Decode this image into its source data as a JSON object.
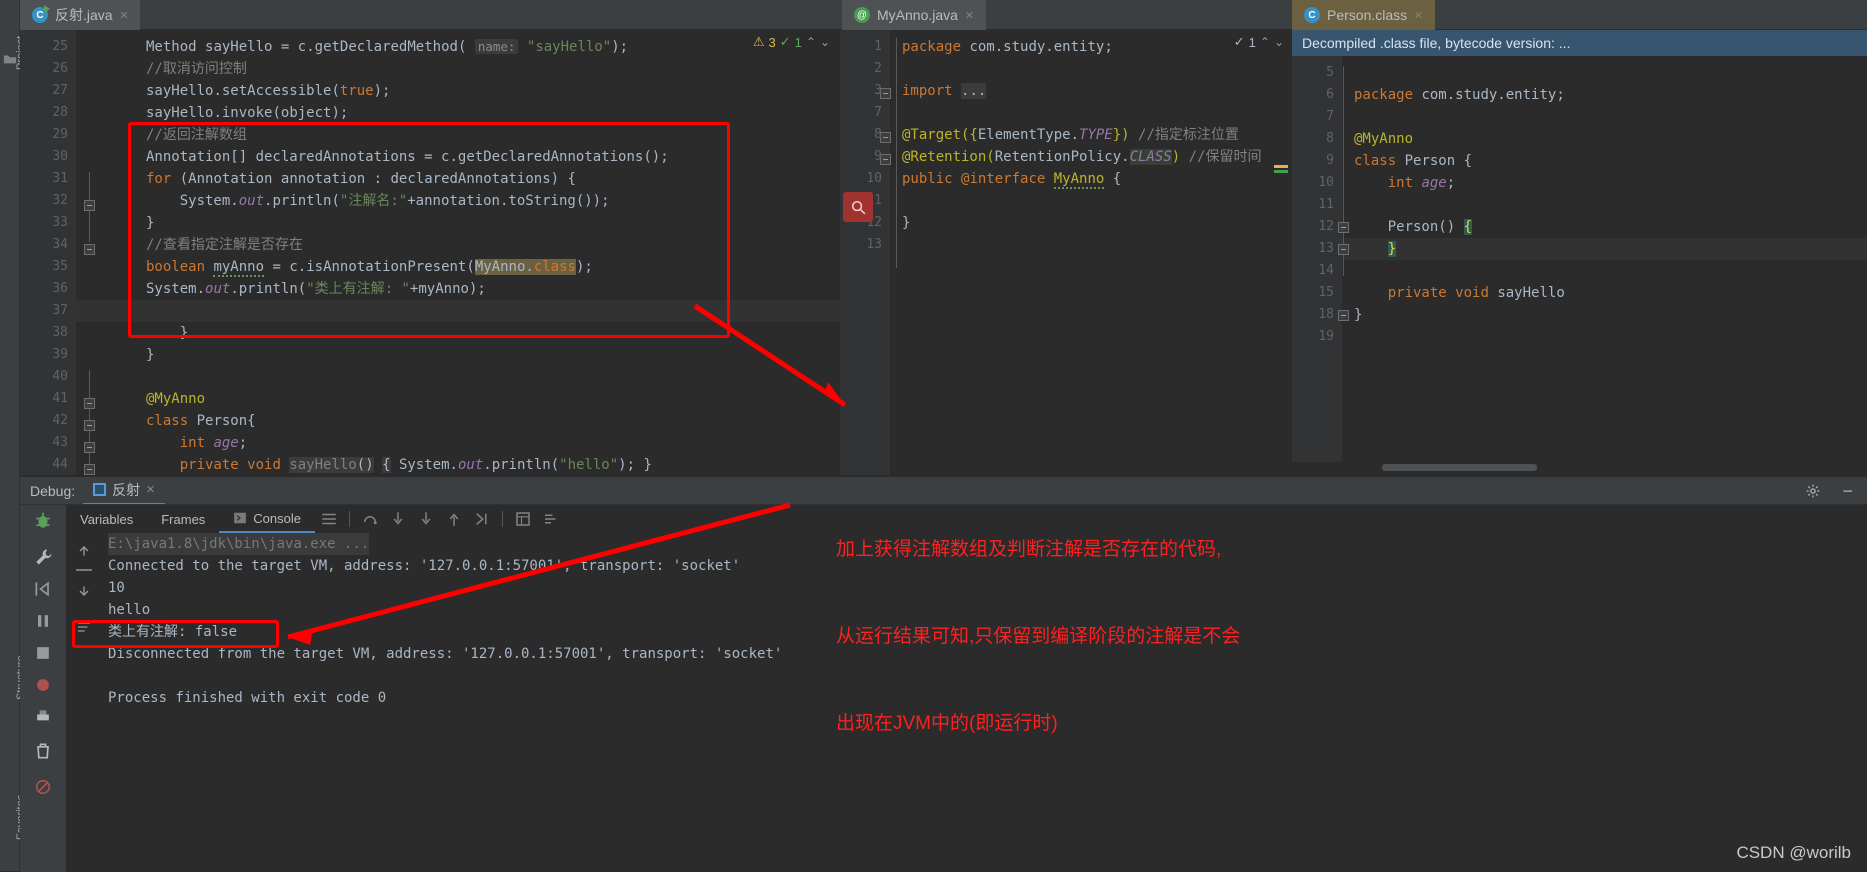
{
  "left_strip": {
    "project_label": "Project",
    "structure_label": "Structure",
    "favorites_label": "Favorites"
  },
  "tabs": [
    {
      "id": "fanshe",
      "label": "反射.java",
      "icon": "java-class-icon",
      "close": "×",
      "selected": true
    },
    {
      "id": "myanno",
      "label": "MyAnno.java",
      "icon": "annotation-icon",
      "close": "×",
      "selected": true
    },
    {
      "id": "person",
      "label": "Person.class",
      "icon": "java-class-icon",
      "close": "×",
      "selected": true
    }
  ],
  "main_editor": {
    "inspection": {
      "warn_count": "3",
      "ok_count": "1",
      "up": "⌃",
      "down": "⌄"
    },
    "lines": [
      {
        "n": "25",
        "html": "<span class='ident'>Method</span> <span class='ident'>sayHello</span> <span class='plain'>=</span> <span class='ident'>c</span><span class='plain'>.</span><span class='ident'>getDeclaredMethod</span><span class='plain'>(</span> <span class='param'>name:</span> <span class='str'>\"sayHello\"</span><span class='plain'>);</span>"
      },
      {
        "n": "26",
        "html": "<span class='cmt'>//取消访问控制</span>"
      },
      {
        "n": "27",
        "html": "<span class='ident'>sayHello</span><span class='plain'>.</span><span class='ident'>setAccessible</span><span class='plain'>(</span><span class='kw'>true</span><span class='plain'>);</span>"
      },
      {
        "n": "28",
        "html": "<span class='ident'>sayHello</span><span class='plain'>.</span><span class='ident'>invoke</span><span class='plain'>(</span><span class='ident'>object</span><span class='plain'>);</span>"
      },
      {
        "n": "29",
        "html": "<span class='cmt'>//返回注解数组</span>"
      },
      {
        "n": "30",
        "html": "<span class='ident'>Annotation[] declaredAnnotations</span> <span class='plain'>=</span> <span class='ident'>c</span><span class='plain'>.</span><span class='ident'>getDeclaredAnnotations</span><span class='plain'>();</span>"
      },
      {
        "n": "31",
        "html": "<span class='kw'>for</span> <span class='plain'>(</span><span class='ident'>Annotation annotation</span> <span class='plain'>:</span> <span class='ident'>declaredAnnotations</span><span class='plain'>) {</span>"
      },
      {
        "n": "32",
        "html": "    <span class='ident'>System</span><span class='plain'>.</span><span class='fld'>out</span><span class='plain'>.</span><span class='ident'>println</span><span class='plain'>(</span><span class='str'>\"注解名:\"</span><span class='plain'>+</span><span class='ident'>annotation</span><span class='plain'>.</span><span class='ident'>toString</span><span class='plain'>());</span>"
      },
      {
        "n": "33",
        "html": "<span class='plain'>}</span>"
      },
      {
        "n": "34",
        "html": "<span class='cmt'>//查看指定注解是否存在</span>"
      },
      {
        "n": "35",
        "html": "<span class='kw'>boolean</span> <span class='ident wavy'>myAnno</span> <span class='plain'>=</span> <span class='ident'>c</span><span class='plain'>.</span><span class='ident'>isAnnotationPresent</span><span class='plain'>(</span><span class='hl'><span class='ident'>MyAnno</span><span class='plain'>.</span><span class='kw'>class</span></span><span class='plain'>);</span>"
      },
      {
        "n": "36",
        "html": "<span class='ident'>System</span><span class='plain'>.</span><span class='fld'>out</span><span class='plain'>.</span><span class='ident'>println</span><span class='plain'>(</span><span class='str'>\"类上有注解: \"</span><span class='plain'>+</span><span class='ident'>myAnno</span><span class='plain'>);</span>"
      },
      {
        "n": "37",
        "html": ""
      },
      {
        "n": "38",
        "html": "<span class='plain'>    }</span>"
      },
      {
        "n": "39",
        "html": "<span class='plain'>}</span>"
      },
      {
        "n": "40",
        "html": ""
      },
      {
        "n": "41",
        "html": "<span class='anno'>@MyAnno</span>"
      },
      {
        "n": "42",
        "html": "<span class='kw'>class</span> <span class='ident'>Person</span><span class='plain'>{</span>"
      },
      {
        "n": "43",
        "html": "    <span class='kw'>int</span> <span class='fld'>age</span><span class='plain'>;</span>"
      },
      {
        "n": "44",
        "html": "    <span class='kw'>private</span> <span class='kw'>void</span> <span class='seldim'><span class='cmt'>sayHello</span><span class='plain'>()</span></span> <span class='seldim'><span class='plain'>{</span></span> <span class='ident'>System</span><span class='plain'>.</span><span class='fld'>out</span><span class='plain'>.</span><span class='ident'>println</span><span class='plain'>(</span><span class='str'>\"hello\"</span><span class='plain'>); }</span>"
      }
    ],
    "current_line": "37"
  },
  "mid_editor": {
    "inspection": {
      "ok_count": "1",
      "up": "⌃",
      "down": "⌄"
    },
    "lines": [
      {
        "n": "1",
        "html": "<span class='kw'>package</span> <span class='ident'>com.study.entity;</span>"
      },
      {
        "n": "2",
        "html": ""
      },
      {
        "n": "3",
        "html": "<span class='kw'>import</span> <span class='seldim'>...</span>"
      },
      {
        "n": "7",
        "html": ""
      },
      {
        "n": "8",
        "html": "<span class='anno'>@Target({</span><span class='ident'>ElementType.</span><span class='fld'>TYPE</span><span class='anno'>})</span> <span class='cmt'>//指定标注位置</span>"
      },
      {
        "n": "9",
        "html": "<span class='anno'>@Retention(</span><span class='ident'>RetentionPolicy.</span><span class='hl2'><span class='fld'>CLASS</span></span><span class='anno'>)</span> <span class='cmt'>//保留时间</span>"
      },
      {
        "n": "10",
        "html": "<span class='kw'>public</span> <span class='kw'>@interface</span> <span class='anno wavy'>MyAnno</span> <span class='plain'>{</span>"
      },
      {
        "n": "11",
        "html": ""
      },
      {
        "n": "12",
        "html": "<span class='plain'>}</span>"
      },
      {
        "n": "13",
        "html": ""
      }
    ],
    "search_icon": "search-icon"
  },
  "right_editor": {
    "banner": "Decompiled .class file, bytecode version: ...",
    "lines": [
      {
        "n": "5",
        "html": ""
      },
      {
        "n": "6",
        "html": "<span class='kw'>package</span> <span class='ident'>com.study.entity;</span>"
      },
      {
        "n": "7",
        "html": ""
      },
      {
        "n": "8",
        "html": "<span class='anno'>@MyAnno</span>"
      },
      {
        "n": "9",
        "html": "<span class='kw'>class</span> <span class='ident'>Person</span> <span class='plain'>{</span>"
      },
      {
        "n": "10",
        "html": "    <span class='kw'>int</span> <span class='fld'>age</span><span class='plain'>;</span>"
      },
      {
        "n": "11",
        "html": ""
      },
      {
        "n": "12",
        "html": "    <span class='ident'>Person</span><span class='plain'>()</span> <span class='selcyan'>{</span>"
      },
      {
        "n": "13",
        "html": "    <span class='selcyan'>}</span>"
      },
      {
        "n": "14",
        "html": ""
      },
      {
        "n": "15",
        "html": "    <span class='kw'>private</span> <span class='kw'>void</span> <span class='ident'>sayHello</span>"
      },
      {
        "n": "18",
        "html": "<span class='plain'>}</span>"
      },
      {
        "n": "19",
        "html": ""
      }
    ],
    "current_line": "13"
  },
  "debug": {
    "panel_label": "Debug:",
    "session_tab": "反射",
    "session_close": "×",
    "settings_icon": "gear-icon",
    "minimize_icon": "−",
    "tabs": [
      {
        "id": "variables",
        "label": "Variables",
        "selected": false
      },
      {
        "id": "frames",
        "label": "Frames",
        "selected": false
      },
      {
        "id": "console",
        "label": "Console",
        "selected": true
      }
    ],
    "console_lines": [
      {
        "text": "E:\\java1.8\\jdk\\bin\\java.exe ...",
        "dim": true
      },
      {
        "text": "Connected to the target VM, address: '127.0.0.1:57001', transport: 'socket'",
        "dim": false
      },
      {
        "text": "10",
        "dim": false
      },
      {
        "text": "hello",
        "dim": false
      },
      {
        "text": "类上有注解: false",
        "dim": false
      },
      {
        "text": "Disconnected from the target VM, address: '127.0.0.1:57001', transport: 'socket'",
        "dim": false
      },
      {
        "text": "",
        "dim": false
      },
      {
        "text": "Process finished with exit code 0",
        "dim": false
      }
    ]
  },
  "annotations": {
    "color": "#ff0000",
    "note_lines": [
      "加上获得注解数组及判断注解是否存在的代码,",
      "从运行结果可知,只保留到编译阶段的注解是不会",
      "出现在JVM中的(即运行时)"
    ]
  },
  "watermark": "CSDN @worilb"
}
